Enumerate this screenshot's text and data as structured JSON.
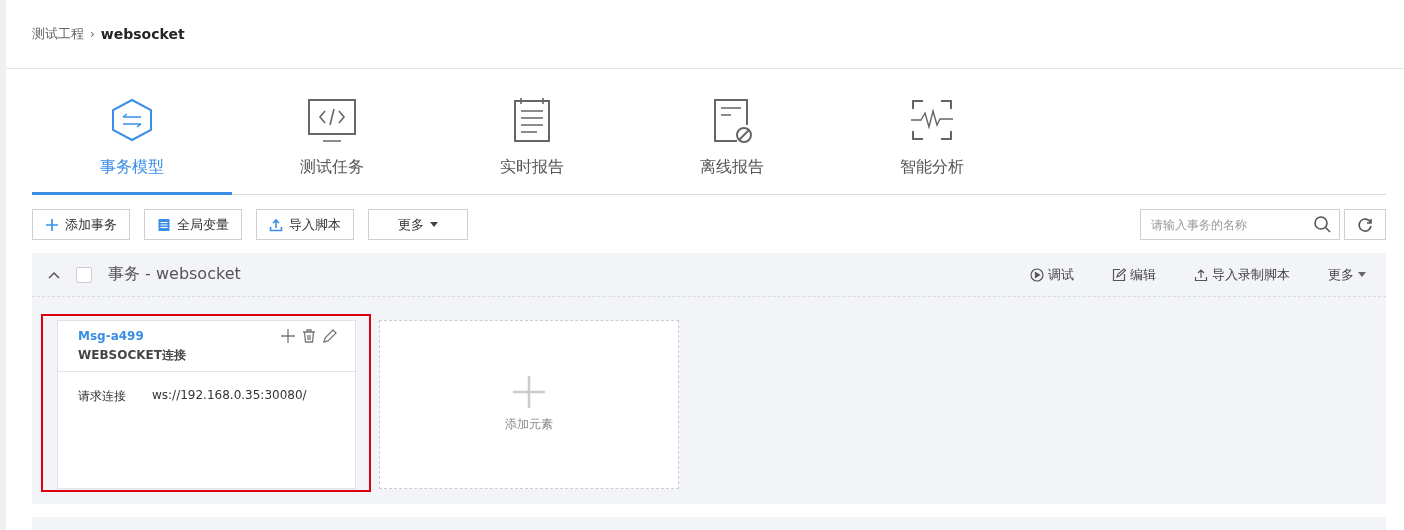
{
  "breadcrumb": {
    "parent": "测试工程",
    "separator": "›",
    "current": "websocket"
  },
  "tabs": [
    {
      "label": "事务模型",
      "kind": "hexagon",
      "selected": true
    },
    {
      "label": "测试任务",
      "kind": "code",
      "selected": false
    },
    {
      "label": "实时报告",
      "kind": "notepad",
      "selected": false
    },
    {
      "label": "离线报告",
      "kind": "docoff",
      "selected": false
    },
    {
      "label": "智能分析",
      "kind": "pulse",
      "selected": false
    }
  ],
  "toolbar": {
    "buttons": [
      {
        "label": "添加事务",
        "kind": "plus"
      },
      {
        "label": "全局变量",
        "kind": "table"
      },
      {
        "label": "导入脚本",
        "kind": "upload"
      },
      {
        "label": "更多",
        "kind": "caret"
      }
    ],
    "search": {
      "placeholder": "请输入事务的名称"
    }
  },
  "transaction": {
    "expanded": true,
    "checked": false,
    "title": "事务 - websocket",
    "actions": [
      {
        "label": "调试",
        "kind": "play"
      },
      {
        "label": "编辑",
        "kind": "edit"
      },
      {
        "label": "导入录制脚本",
        "kind": "upload"
      },
      {
        "label": "更多",
        "kind": "caret"
      }
    ],
    "cards": [
      {
        "kind": "element",
        "highlighted": true,
        "name": "Msg-a499",
        "type": "WEBSOCKET连接",
        "field_label": "请求连接",
        "field_value": "ws://192.168.0.35:30080/"
      },
      {
        "kind": "add",
        "label": "添加元素"
      }
    ]
  }
}
